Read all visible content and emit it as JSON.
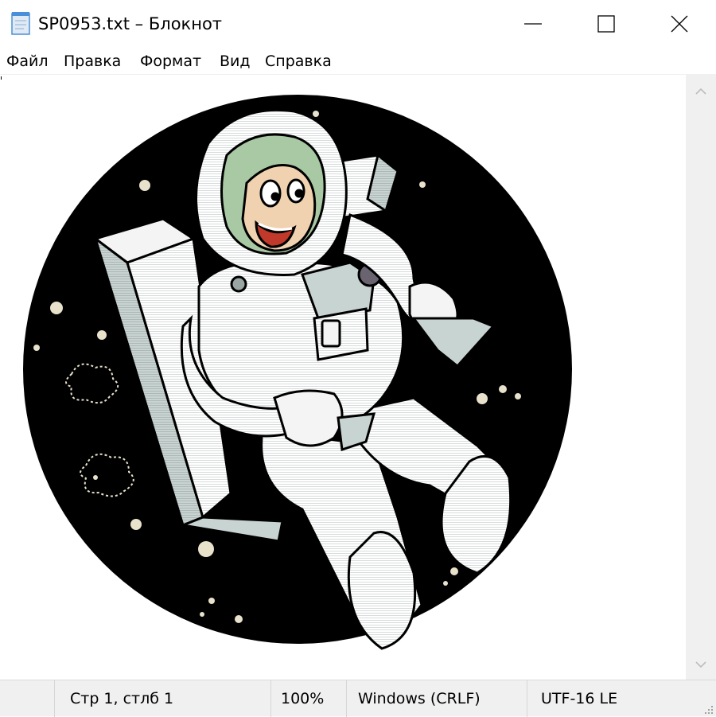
{
  "window": {
    "title": "SP0953.txt – Блокнот",
    "controls": {
      "minimize": "minimize-icon",
      "maximize": "maximize-icon",
      "close": "close-icon"
    }
  },
  "menu": {
    "items": [
      "Файл",
      "Правка",
      "Формат",
      "Вид",
      "Справка"
    ]
  },
  "status": {
    "position": "Стр 1, стлб 1",
    "zoom": "100%",
    "line_endings": "Windows (CRLF)",
    "encoding": "UTF-16 LE"
  },
  "colors": {
    "chrome_bg": "#f0f0f0",
    "editor_bg": "#ffffff",
    "art_black": "#000000",
    "suit_white": "#f4f4f4",
    "suit_shade": "#c8d4d2",
    "visor_green": "#a9c9a4",
    "face_skin": "#f1d2b0",
    "star_color": "#e8e2cc"
  }
}
